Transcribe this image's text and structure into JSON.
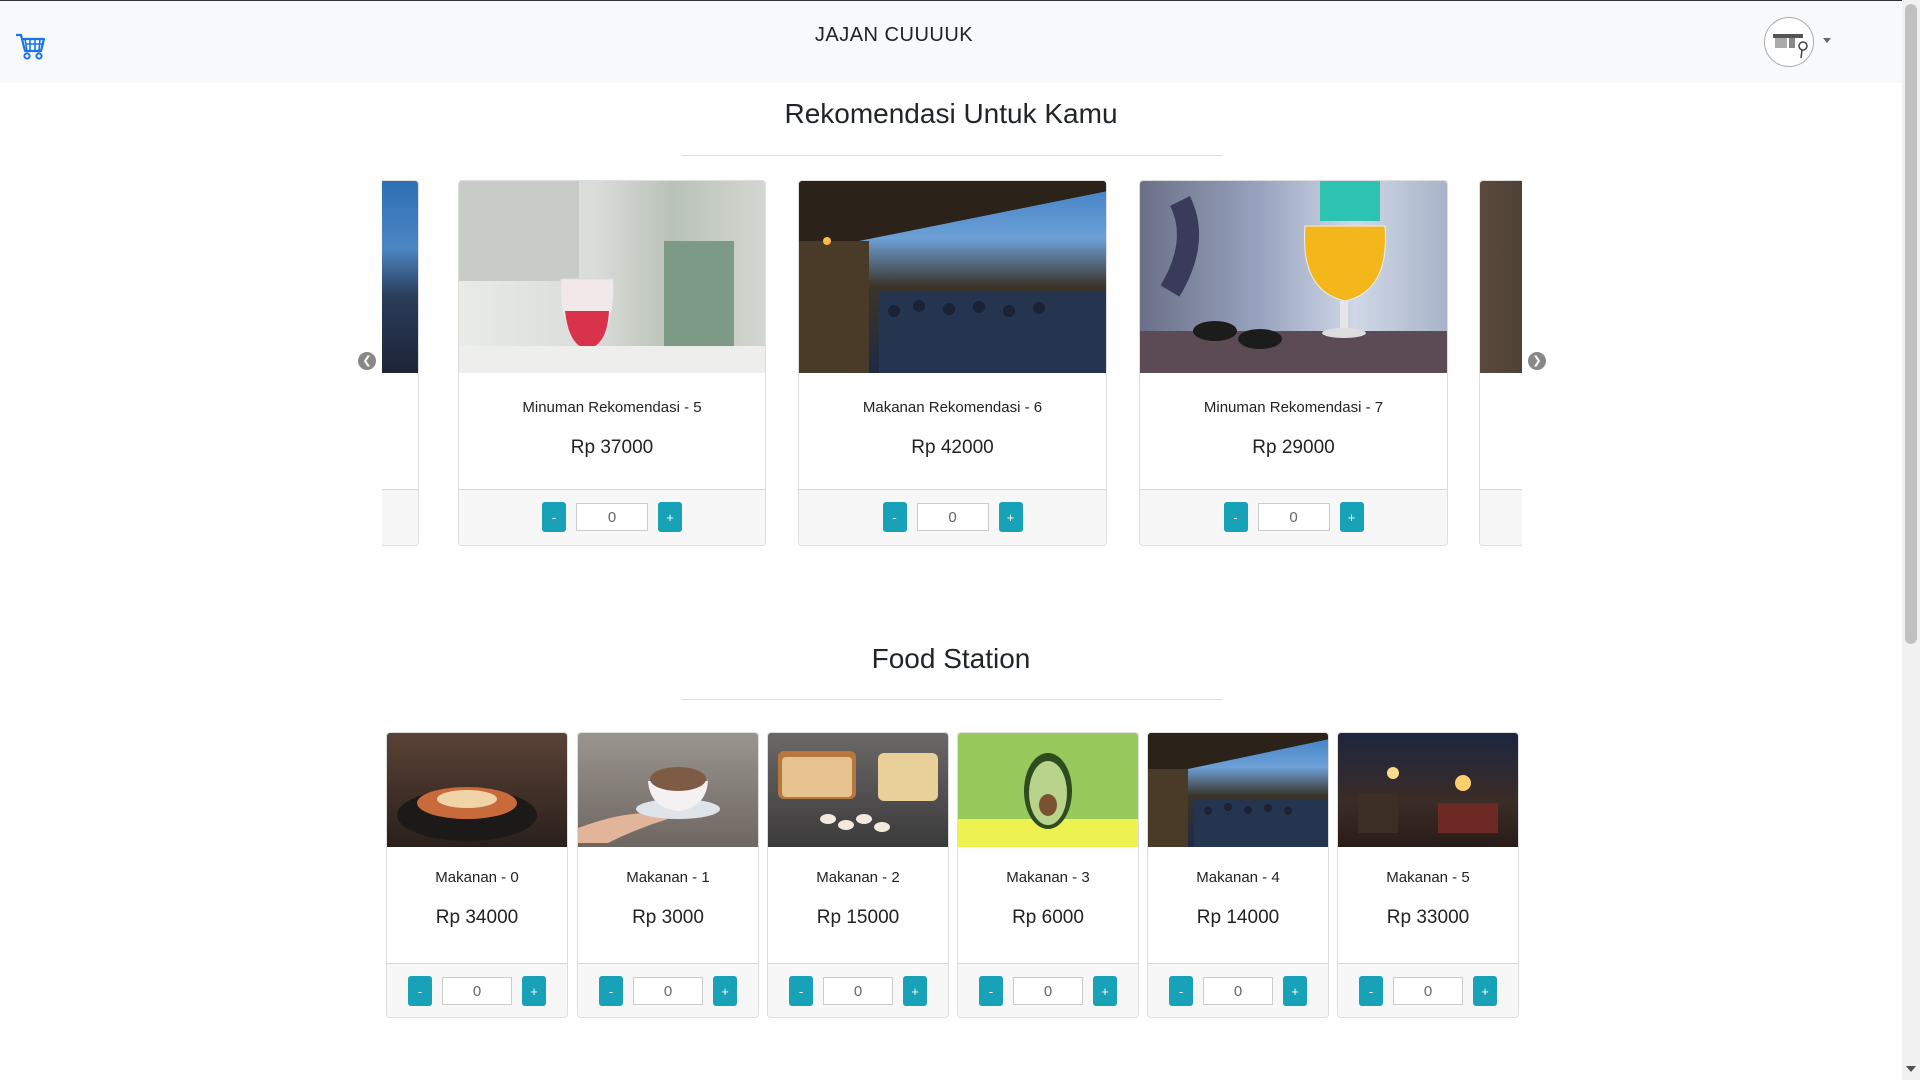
{
  "navbar": {
    "brand": "JAJAN CUUUUK",
    "cart_icon": "cart-icon",
    "avatar_icon": "avatar"
  },
  "recommend": {
    "title": "Rekomendasi Untuk Kamu",
    "items": [
      {
        "name": "Minuman Rekomendasi - 5",
        "price": "Rp 37000",
        "qty": "0",
        "minus": "-",
        "plus": "+"
      },
      {
        "name": "Makanan Rekomendasi - 6",
        "price": "Rp 42000",
        "qty": "0",
        "minus": "-",
        "plus": "+"
      },
      {
        "name": "Minuman Rekomendasi - 7",
        "price": "Rp 29000",
        "qty": "0",
        "minus": "-",
        "plus": "+"
      }
    ],
    "prev_icon": "chevron-left-icon",
    "next_icon": "chevron-right-icon"
  },
  "food": {
    "title": "Food Station",
    "items": [
      {
        "name": "Makanan - 0",
        "price": "Rp 34000",
        "qty": "0",
        "minus": "-",
        "plus": "+"
      },
      {
        "name": "Makanan - 1",
        "price": "Rp 3000",
        "qty": "0",
        "minus": "-",
        "plus": "+"
      },
      {
        "name": "Makanan - 2",
        "price": "Rp 15000",
        "qty": "0",
        "minus": "-",
        "plus": "+"
      },
      {
        "name": "Makanan - 3",
        "price": "Rp 6000",
        "qty": "0",
        "minus": "-",
        "plus": "+"
      },
      {
        "name": "Makanan - 4",
        "price": "Rp 14000",
        "qty": "0",
        "minus": "-",
        "plus": "+"
      },
      {
        "name": "Makanan - 5",
        "price": "Rp 33000",
        "qty": "0",
        "minus": "-",
        "plus": "+"
      }
    ]
  },
  "colors": {
    "accent": "#17a2b8",
    "navbar_bg": "#f8f9fa",
    "cart_blue": "#1a73e8"
  }
}
